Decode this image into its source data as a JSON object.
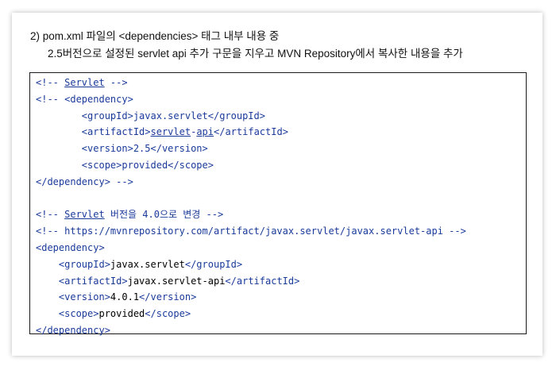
{
  "heading": {
    "line1": "2)  pom.xml 파일의 <dependencies> 태그 내부 내용 중",
    "line2": "2.5버전으로 설정된 servlet api 추가 구문을 지우고 MVN Repository에서 복사한 내용을 추가"
  },
  "code": {
    "old_block": {
      "comment_open": "<!-- ",
      "comment_word": "Servlet",
      "comment_close": " -->",
      "dep_open": "<!-- <dependency>",
      "group_line": "        <groupId>javax.servlet</groupId>",
      "artifact_prefix": "        <artifactId>",
      "artifact_w1": "servlet",
      "artifact_dash": "-",
      "artifact_w2": "api",
      "artifact_suffix": "</artifactId>",
      "version_line": "        <version>2.5</version>",
      "scope_line": "        <scope>provided</scope>",
      "dep_close": "</dependency> -->"
    },
    "new_block": {
      "comment1_open": "<!-- ",
      "comment1_word": "Servlet",
      "comment1_rest": " 버전을 4.0으로 변경 -->",
      "comment2": "<!-- https://mvnrepository.com/artifact/javax.servlet/javax.servlet-api -->",
      "dep_open": "<dependency>",
      "group_open": "    <groupId>",
      "group_value": "javax.servlet",
      "group_close": "</groupId>",
      "artifact_open": "    <artifactId>",
      "artifact_value": "javax.servlet-api",
      "artifact_close": "</artifactId>",
      "version_open": "    <version>",
      "version_value": "4.0.1",
      "version_close": "</version>",
      "scope_open": "    <scope>",
      "scope_value": "provided",
      "scope_close": "</scope>",
      "dep_close": "</dependency>"
    }
  }
}
